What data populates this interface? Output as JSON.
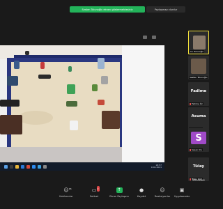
{
  "top_bar": {
    "share_banner": "Sesten Tolunoğlu ekranı göstermektesiniz",
    "stop_share_button": "Paylaşmayı durdur"
  },
  "shared_screen": {
    "taskbar_time": "18:57",
    "taskbar_date": "9.04.2021"
  },
  "participants": {
    "top_speaker_name": "Cu Tolunoğlu",
    "second_name": "Sesten Tolunoğlu",
    "row1_label": "Fadime",
    "row1_sub": "Fadime Öz",
    "row2_label": "Asuma",
    "row2_sub": "Asuma Ka",
    "row3_big": "S",
    "row3_sub": "Sesen Ulu",
    "row4_label": "Tülay",
    "row4_sub": "Tülay Güll",
    "windows_hint": "Windows"
  },
  "toolbar": {
    "participants_label": "Katılımcılar",
    "participants_count": "16",
    "chat_label": "Sohbet",
    "chat_badge": "2",
    "share_label": "Ekran Paylaşımı",
    "record_label": "Kaydet",
    "reactions_label": "Reaksiyonlar",
    "apps_label": "Uygulamalar"
  },
  "colors": {
    "accent_green": "#23b35a",
    "speaking_border": "#f2e03a",
    "muted_red": "#e24a4a",
    "avatar_purple": "#a04ac7",
    "sand_tray_blue": "#2a3780"
  }
}
